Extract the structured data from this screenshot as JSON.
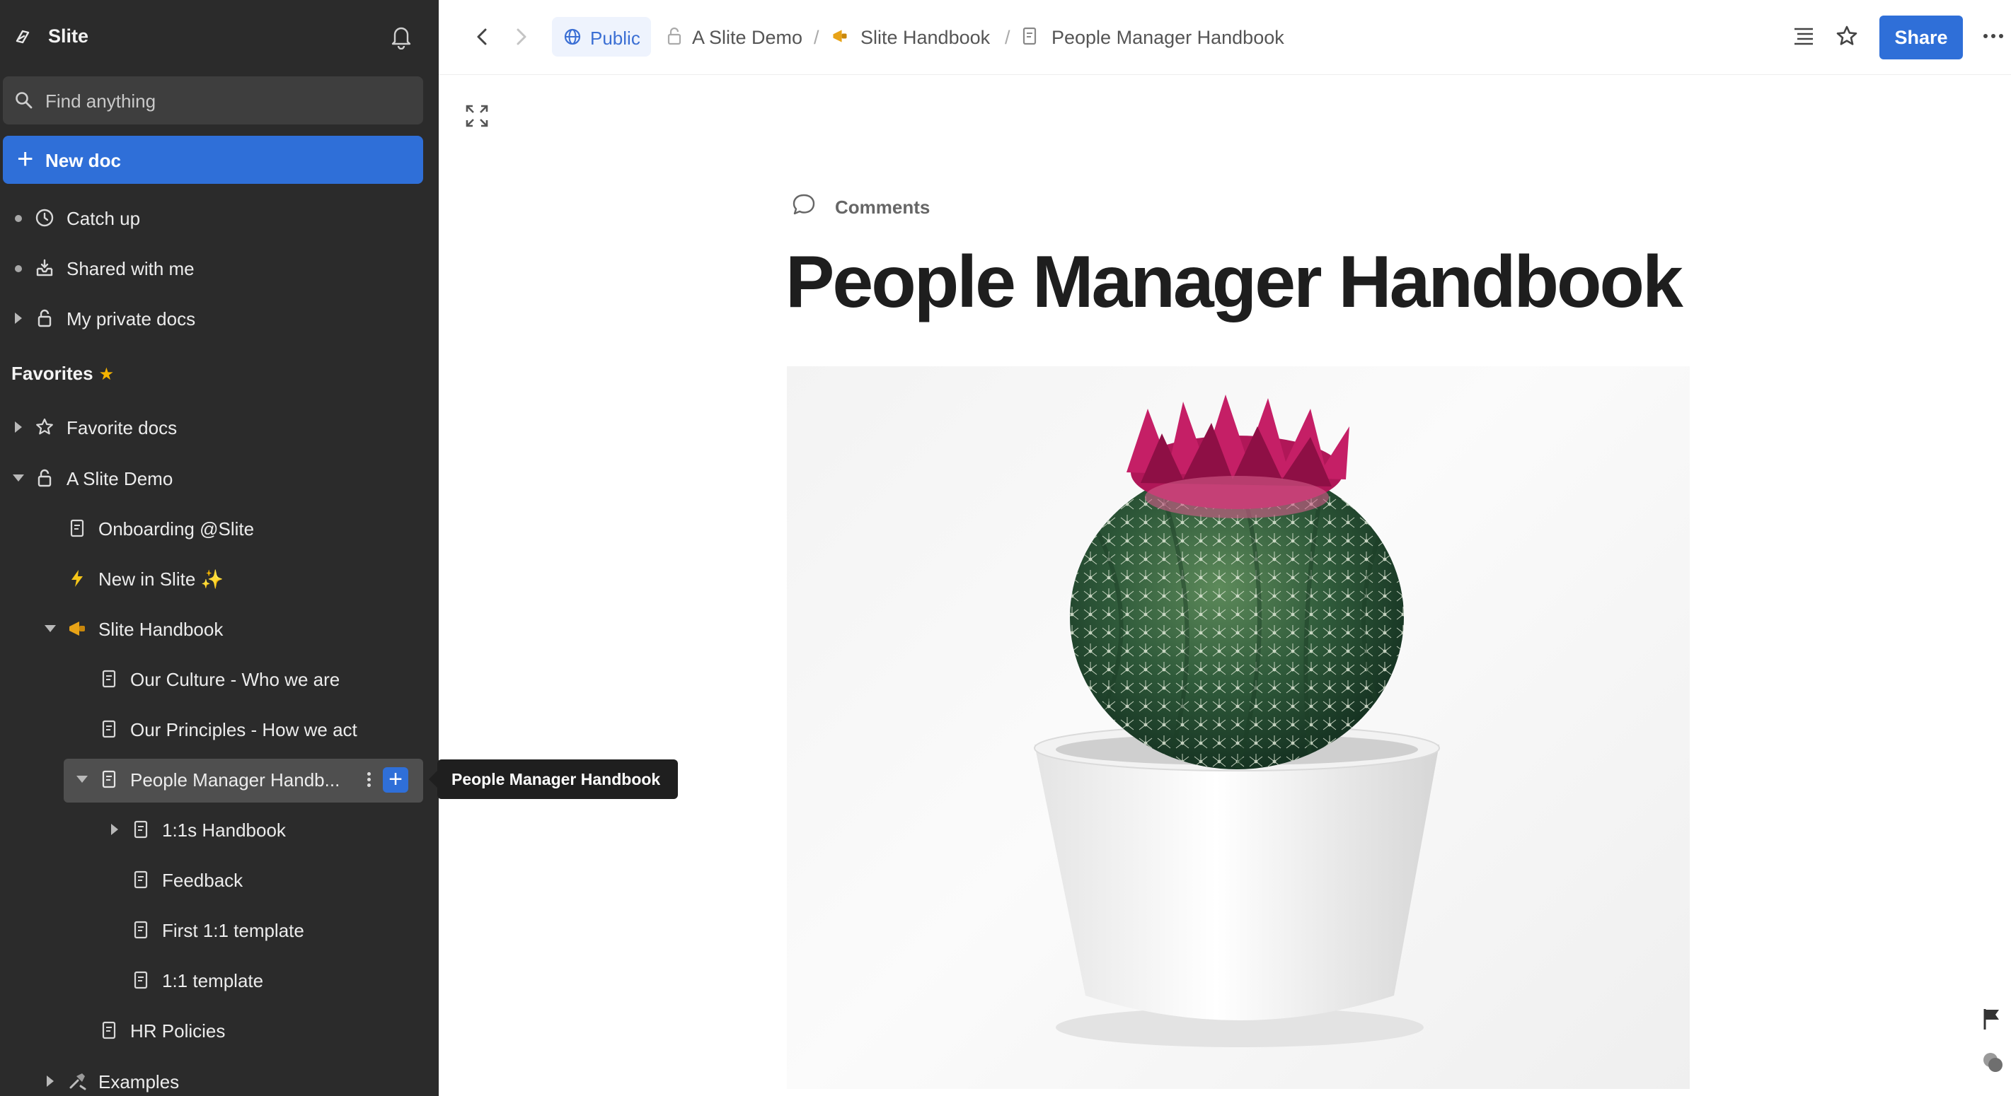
{
  "app": {
    "name": "Slite"
  },
  "sidebar": {
    "search_placeholder": "Find anything",
    "new_doc_label": "New doc",
    "nav": [
      {
        "label": "Catch up"
      },
      {
        "label": "Shared with me"
      },
      {
        "label": "My private docs"
      }
    ],
    "favorites_heading": "Favorites",
    "favorites_star": "★",
    "tree": [
      {
        "label": "Favorite docs"
      },
      {
        "label": "A Slite Demo"
      },
      {
        "label": "Onboarding @Slite"
      },
      {
        "label": "New in Slite ✨"
      },
      {
        "label": "Slite Handbook"
      },
      {
        "label": "Our Culture - Who we are"
      },
      {
        "label": "Our Principles - How we act"
      },
      {
        "label": "People Manager Handb..."
      },
      {
        "label": "1:1s Handbook"
      },
      {
        "label": "Feedback"
      },
      {
        "label": "First 1:1 template"
      },
      {
        "label": "1:1 template"
      },
      {
        "label": "HR Policies"
      },
      {
        "label": "Examples"
      }
    ],
    "row_add_label": "+"
  },
  "tooltip": {
    "text": "People Manager Handbook"
  },
  "topbar": {
    "visibility_label": "Public",
    "breadcrumb": [
      {
        "label": "A Slite Demo"
      },
      {
        "label": "Slite Handbook"
      },
      {
        "label": "People Manager Handbook"
      }
    ],
    "separator": "/",
    "share_label": "Share"
  },
  "document": {
    "comments_label": "Comments",
    "title": "People Manager Handbook"
  },
  "colors": {
    "sidebar_bg": "#2b2b2b",
    "accent": "#2f6fd8",
    "favorite_star": "#f5b400"
  },
  "icons": {
    "logo": "slite-logo-icon",
    "bell": "bell-icon",
    "search": "search-icon",
    "clock": "clock-icon",
    "inbox": "inbox-icon",
    "lock": "lock-icon",
    "star": "star-icon",
    "doc": "document-icon",
    "globe": "globe-icon",
    "toc": "table-of-contents-icon",
    "more": "more-icon",
    "expand": "expand-icon",
    "comment": "comment-icon",
    "flag": "flag-icon",
    "chat": "chat-bubble-icon"
  }
}
